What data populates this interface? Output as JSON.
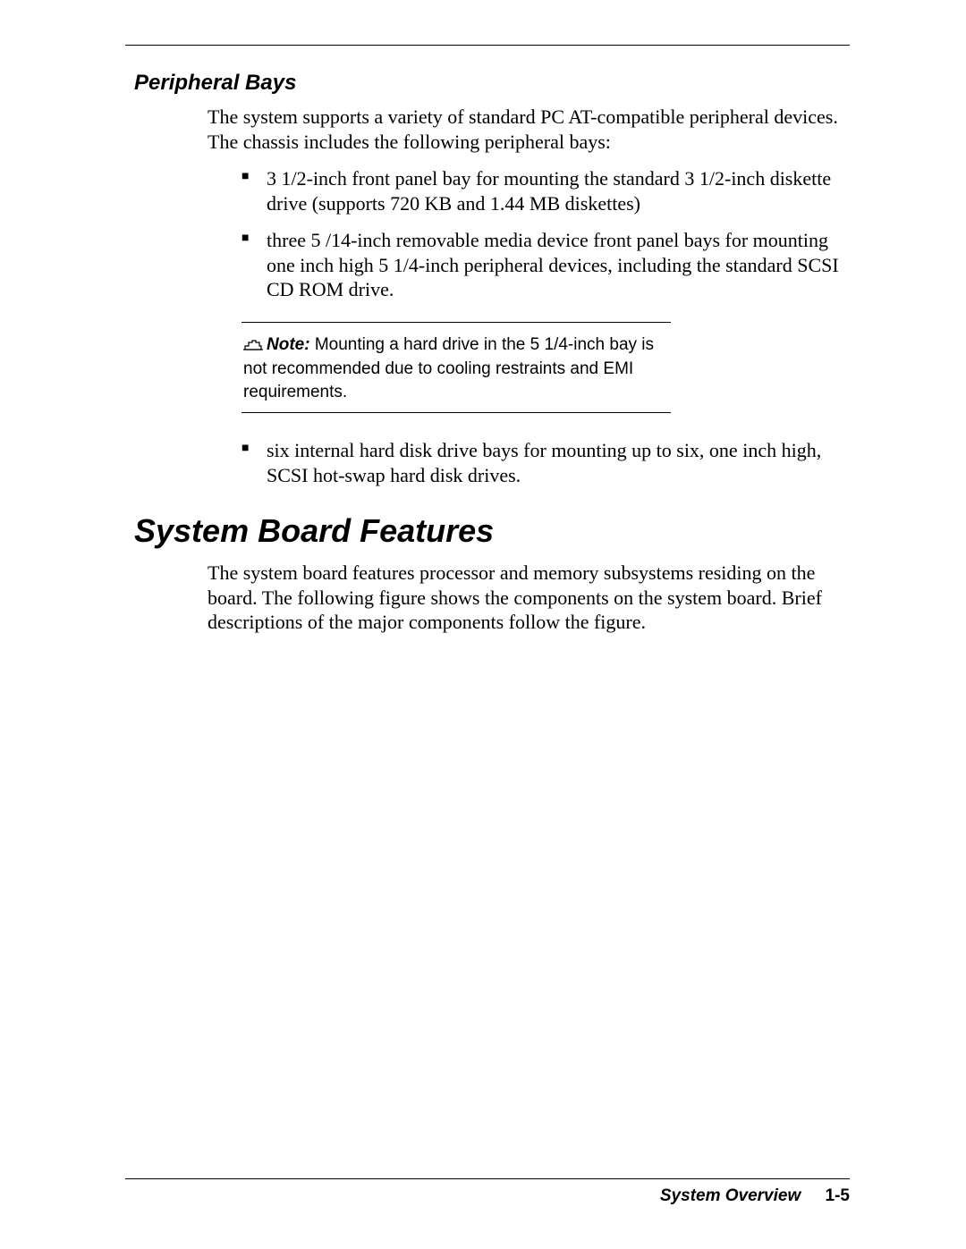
{
  "section": {
    "subheading": "Peripheral Bays",
    "intro": "The system supports a variety of standard PC AT-compatible peripheral devices. The chassis includes the following peripheral bays:",
    "bullets_group1": [
      "3 1/2-inch front panel bay for mounting the standard 3 1/2-inch diskette drive (supports 720 KB and 1.44 MB diskettes)",
      "three 5 /14-inch removable media device front panel bays for mounting one inch high 5 1/4-inch peripheral devices, including the standard SCSI CD ROM drive."
    ],
    "note": {
      "label": "Note:",
      "text": " Mounting a hard drive in the 5 1/4-inch bay is not recommended due to cooling restraints and EMI requirements."
    },
    "bullets_group2": [
      "six internal hard disk drive bays for mounting up to six, one inch high, SCSI hot-swap hard disk drives."
    ]
  },
  "main_heading": "System Board Features",
  "main_para": "The system board features processor and memory subsystems residing on the board. The following figure shows the components on the system board. Brief descriptions of the major components follow the figure.",
  "footer": {
    "title": "System Overview",
    "page": "1-5"
  }
}
